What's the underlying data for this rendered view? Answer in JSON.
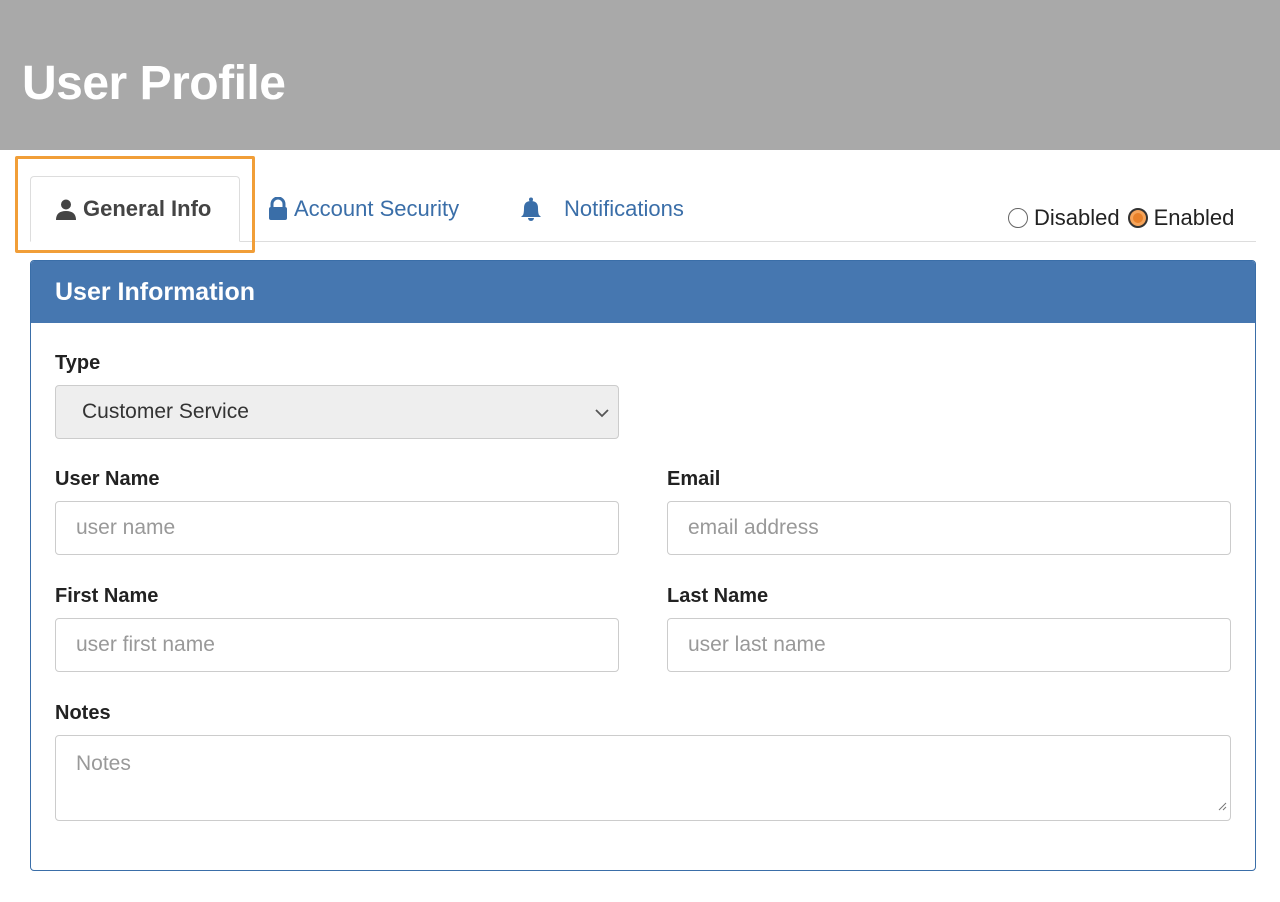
{
  "header": {
    "title": "User Profile"
  },
  "tabs": [
    {
      "label": "General Info",
      "icon": "user-icon",
      "active": true
    },
    {
      "label": "Account Security",
      "icon": "lock-icon",
      "active": false
    },
    {
      "label": "Notifications",
      "icon": "bell-icon",
      "active": false
    }
  ],
  "status": {
    "options": [
      "Disabled",
      "Enabled"
    ],
    "selected": "Enabled"
  },
  "panel": {
    "title": "User Information",
    "type": {
      "label": "Type",
      "value": "Customer Service"
    },
    "user_name": {
      "label": "User Name",
      "placeholder": "user name"
    },
    "email": {
      "label": "Email",
      "placeholder": "email address"
    },
    "first_name": {
      "label": "First Name",
      "placeholder": "user first name"
    },
    "last_name": {
      "label": "Last Name",
      "placeholder": "user last name"
    },
    "notes": {
      "label": "Notes",
      "placeholder": "Notes"
    }
  },
  "colors": {
    "header_bg": "#a9a9a9",
    "panel_head": "#4677b0",
    "link": "#3a6ea8",
    "highlight": "#f19e38",
    "radio_selected": "#e8812a"
  }
}
